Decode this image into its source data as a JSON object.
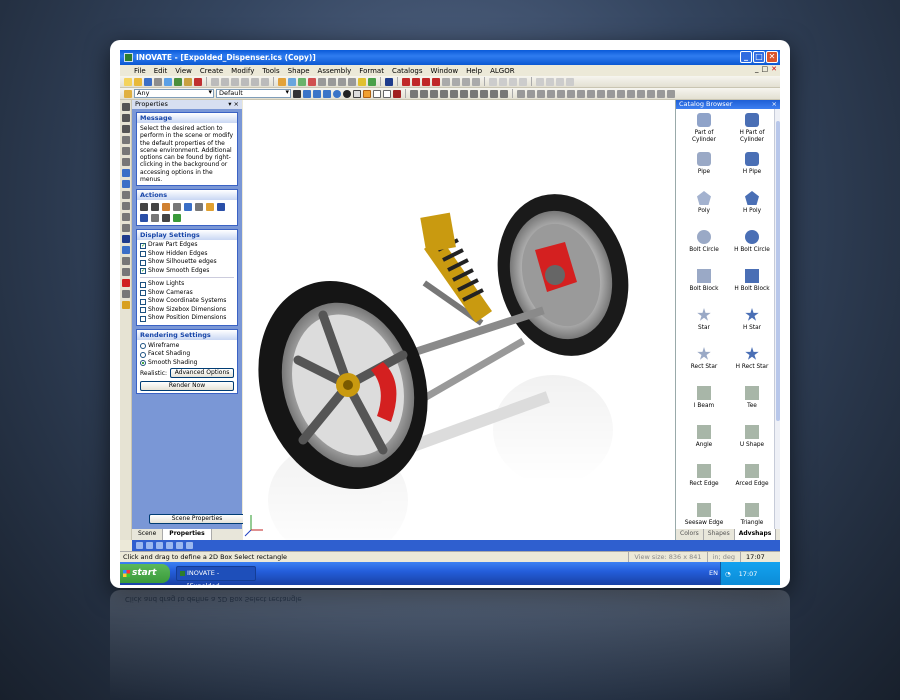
{
  "window": {
    "title": "INOVATE - [Expolded_Dispenser.ics (Copy)]",
    "controls": [
      "_",
      "□",
      "✕"
    ]
  },
  "menu": [
    "File",
    "Edit",
    "View",
    "Create",
    "Modify",
    "Tools",
    "Shape",
    "Assembly",
    "Format",
    "Catalogs",
    "Window",
    "Help",
    "ALGOR"
  ],
  "mdi_controls": [
    "_",
    "□",
    "✕"
  ],
  "toolbar": {
    "filter_value": "Any",
    "style_value": "Default"
  },
  "properties_panel": {
    "title": "Properties",
    "pin": "▾ ×",
    "message": {
      "title": "Message",
      "text": "Select the desired action to perform in the scene or modify the default properties of the scene environment. Additional options can be found by right-clicking in the background or accessing options in the menus."
    },
    "actions_title": "Actions",
    "display": {
      "title": "Display Settings",
      "items": [
        {
          "label": "Draw Part Edges",
          "checked": true
        },
        {
          "label": "Show Hidden Edges",
          "checked": false
        },
        {
          "label": "Show Silhouette edges",
          "checked": false
        },
        {
          "label": "Show Smooth Edges",
          "checked": true
        },
        {
          "label": "Show Lights",
          "checked": false
        },
        {
          "label": "Show Cameras",
          "checked": false
        },
        {
          "label": "Show Coordinate Systems",
          "checked": false
        },
        {
          "label": "Show Sizebox Dimensions",
          "checked": false
        },
        {
          "label": "Show Position Dimensions",
          "checked": false
        }
      ]
    },
    "rendering": {
      "title": "Rendering Settings",
      "options": [
        {
          "label": "Wireframe",
          "selected": false
        },
        {
          "label": "Facet Shading",
          "selected": false
        },
        {
          "label": "Smooth Shading",
          "selected": true
        }
      ],
      "realistic_label": "Realistic:",
      "advanced_button": "Advanced Options",
      "render_button": "Render Now"
    },
    "scene_properties_button": "Scene Properties",
    "tabs": [
      "Scene",
      "Properties"
    ]
  },
  "catalog": {
    "title": "Catalog Browser",
    "close": "×",
    "items": [
      {
        "label": "Part of Cylinder",
        "icon": "cylinder-part"
      },
      {
        "label": "H Part of Cylinder",
        "icon": "cylinder-part-hole"
      },
      {
        "label": "Pipe",
        "icon": "pipe"
      },
      {
        "label": "H Pipe",
        "icon": "pipe-hole"
      },
      {
        "label": "Poly",
        "icon": "poly"
      },
      {
        "label": "H Poly",
        "icon": "poly-hole"
      },
      {
        "label": "Bolt Circle",
        "icon": "bolt-circle"
      },
      {
        "label": "H Bolt Circle",
        "icon": "bolt-circle-hole"
      },
      {
        "label": "Bolt Block",
        "icon": "bolt-block"
      },
      {
        "label": "H Bolt Block",
        "icon": "bolt-block-hole"
      },
      {
        "label": "Star",
        "icon": "star"
      },
      {
        "label": "H Star",
        "icon": "star-hole"
      },
      {
        "label": "Rect Star",
        "icon": "rect-star"
      },
      {
        "label": "H Rect Star",
        "icon": "rect-star-hole"
      },
      {
        "label": "I Beam",
        "icon": "i-beam"
      },
      {
        "label": "Tee",
        "icon": "tee"
      },
      {
        "label": "Angle",
        "icon": "angle"
      },
      {
        "label": "U Shape",
        "icon": "u-shape"
      },
      {
        "label": "Rect Edge",
        "icon": "rect-edge"
      },
      {
        "label": "Arced Edge",
        "icon": "arced-edge"
      },
      {
        "label": "Seesaw Edge",
        "icon": "seesaw-edge"
      },
      {
        "label": "Triangle",
        "icon": "triangle"
      }
    ],
    "tabs": [
      "Colors",
      "Shapes",
      "Advshaps"
    ]
  },
  "status": {
    "message": "Click and drag to define a 2D Box Select rectangle",
    "view_size": "View size: 836 x 841",
    "units": "in; deg",
    "time": "17:07"
  },
  "taskbar": {
    "start": "start",
    "task": "INOVATE - [Expolded...",
    "lang": "EN",
    "clock": "17:07"
  },
  "colors": {
    "title_blue": "#0a5ad8",
    "panel_blue": "#7a97d6",
    "brake_red": "#d42020",
    "spring_gold": "#c99a10",
    "tire_black": "#1a1a1a"
  }
}
